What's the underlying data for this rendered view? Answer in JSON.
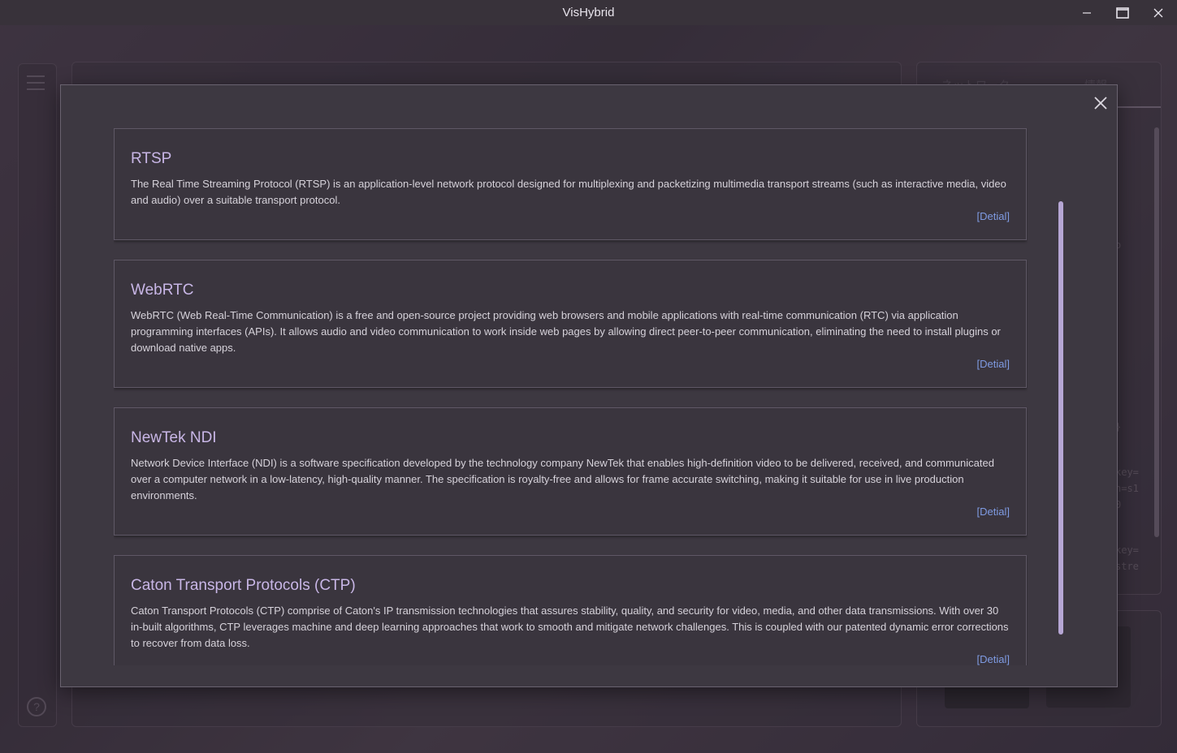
{
  "window": {
    "title": "VisHybrid"
  },
  "background": {
    "right_tabs": [
      "ネットワーク",
      "情報"
    ],
    "snippets": [
      "o",
      "",
      "",
      "}",
      "key=",
      "h=s1",
      "0",
      "key=",
      "stre"
    ]
  },
  "dialog": {
    "cards": [
      {
        "title": "RTSP",
        "description": "The Real Time Streaming Protocol (RTSP) is an application-level network protocol designed for multiplexing and packetizing multimedia transport streams (such as interactive media, video and audio) over a suitable transport protocol.",
        "link": "[Detial]"
      },
      {
        "title": "WebRTC",
        "description": "WebRTC (Web Real-Time Communication) is a free and open-source project providing web browsers and mobile applications with real-time communication (RTC) via application programming interfaces (APIs). It allows audio and video communication to work inside web pages by allowing direct peer-to-peer communication, eliminating the need to install plugins or download native apps.",
        "link": "[Detial]"
      },
      {
        "title": "NewTek NDI",
        "description": "Network Device Interface (NDI) is a software specification developed by the technology company NewTek that enables high-definition video to be delivered, received, and communicated over a computer network in a low-latency, high-quality manner. The specification is royalty-free and allows for frame accurate switching, making it suitable for use in live production environments.",
        "link": "[Detial]"
      },
      {
        "title": "Caton Transport Protocols (CTP)",
        "description": "Caton Transport Protocols (CTP) comprise of Caton's IP transmission technologies that assures stability, quality, and security for video, media, and other data transmissions. With over 30 in-built algorithms, CTP leverages machine and deep learning approaches that work to smooth and mitigate network challenges. This is coupled with our patented dynamic error corrections to recover from data loss.",
        "link": "[Detial]"
      }
    ]
  },
  "icons": {
    "minimize": "minimize-icon",
    "maximize": "maximize-icon",
    "close": "close-icon",
    "dialog_close": "close-icon",
    "menu": "hamburger-menu-icon",
    "help": "help-icon"
  },
  "colors": {
    "title_accent": "#c8b6e6",
    "link": "#7f9be3",
    "dialog_bg": "#3d3841",
    "scrollbar": "#b6a6d4"
  }
}
